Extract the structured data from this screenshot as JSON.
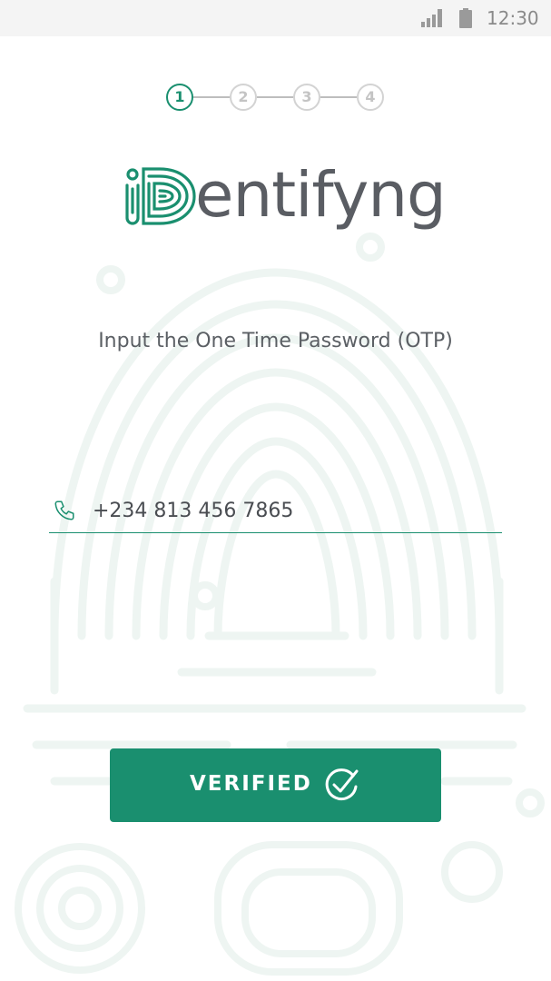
{
  "status_bar": {
    "time": "12:30",
    "signal_icon": "signal-icon",
    "battery_icon": "battery-icon"
  },
  "stepper": {
    "steps": [
      {
        "label": "1",
        "state": "active"
      },
      {
        "label": "2",
        "state": "inactive"
      },
      {
        "label": "3",
        "state": "inactive"
      },
      {
        "label": "4",
        "state": "inactive"
      }
    ]
  },
  "logo": {
    "wordmark_suffix": "entifyng",
    "logo_lettering": "iDentifyng"
  },
  "instruction": {
    "text": "Input the One Time Password (OTP)"
  },
  "phone_field": {
    "icon": "phone-icon",
    "value": "+234 813 456 7865"
  },
  "verify_button": {
    "label": "VERIFIED",
    "icon": "check-circle-icon"
  },
  "colors": {
    "brand": "#1a8f6f",
    "text_gray": "#5b5f64",
    "step_inactive": "#c4c4c4",
    "status_bar_bg": "#f4f4f4"
  }
}
